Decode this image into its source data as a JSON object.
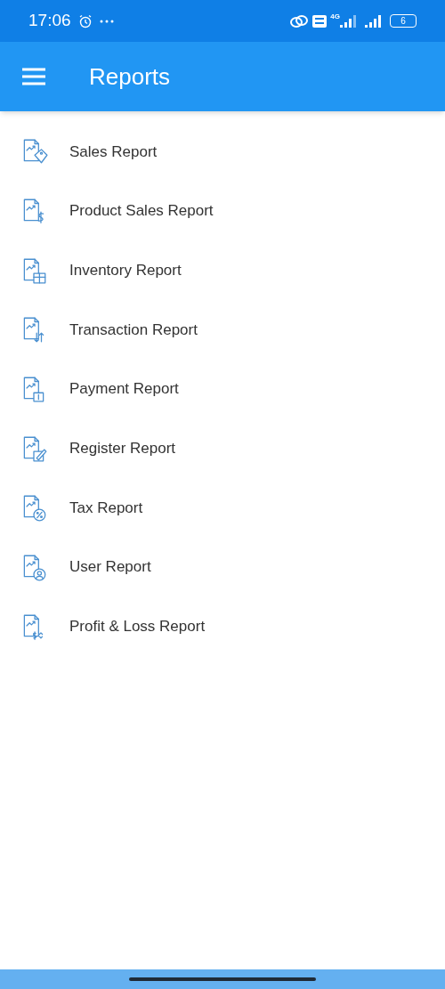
{
  "status_bar": {
    "time": "17:06",
    "network": "4G",
    "battery": "6"
  },
  "app_bar": {
    "title": "Reports"
  },
  "reports": [
    {
      "label": "Sales Report",
      "kind": "tag"
    },
    {
      "label": "Product Sales Report",
      "kind": "dollar"
    },
    {
      "label": "Inventory Report",
      "kind": "box"
    },
    {
      "label": "Transaction Report",
      "kind": "arrows"
    },
    {
      "label": "Payment Report",
      "kind": "payment"
    },
    {
      "label": "Register Report",
      "kind": "pencil"
    },
    {
      "label": "Tax Report",
      "kind": "percent"
    },
    {
      "label": "User Report",
      "kind": "user"
    },
    {
      "label": "Profit & Loss Report",
      "kind": "profit"
    }
  ]
}
